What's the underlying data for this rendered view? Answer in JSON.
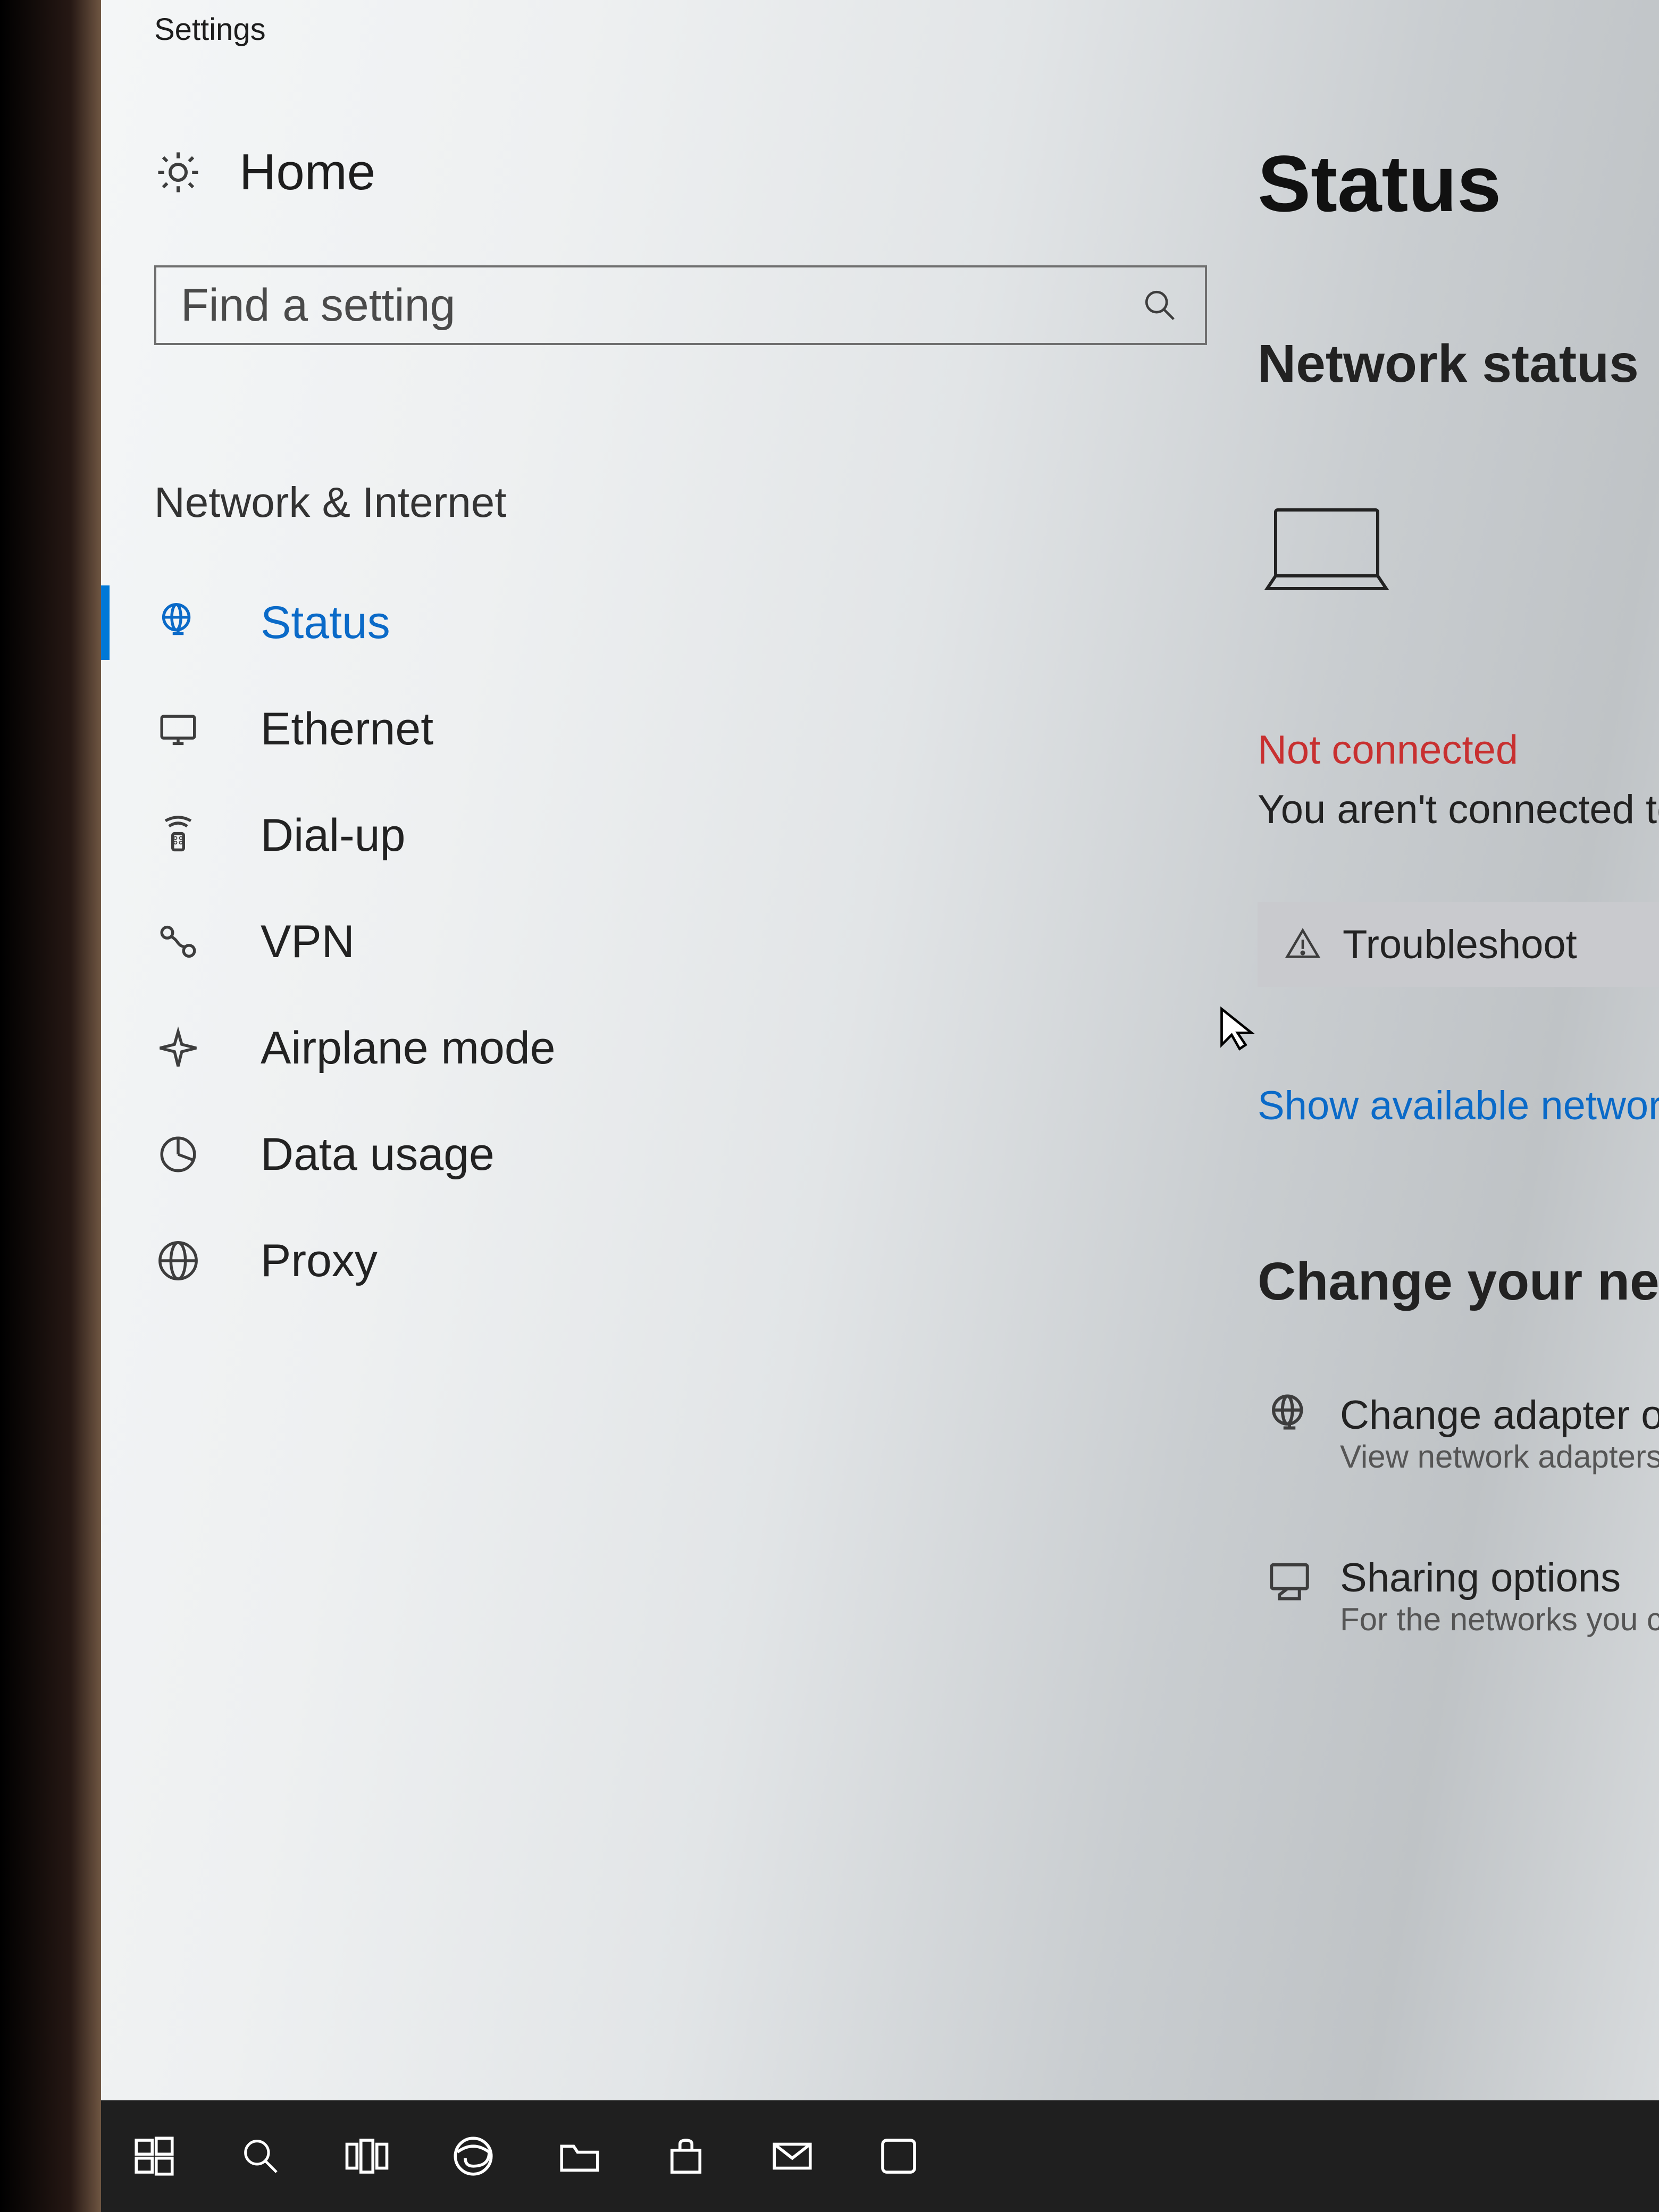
{
  "window_title": "Settings",
  "home_label": "Home",
  "search": {
    "placeholder": "Find a setting"
  },
  "category_heading": "Network & Internet",
  "nav_items": [
    {
      "label": "Status",
      "active": true,
      "icon": "globe-monitor-icon"
    },
    {
      "label": "Ethernet",
      "active": false,
      "icon": "monitor-icon"
    },
    {
      "label": "Dial-up",
      "active": false,
      "icon": "phone-icon"
    },
    {
      "label": "VPN",
      "active": false,
      "icon": "vpn-icon"
    },
    {
      "label": "Airplane mode",
      "active": false,
      "icon": "airplane-icon"
    },
    {
      "label": "Data usage",
      "active": false,
      "icon": "pie-icon"
    },
    {
      "label": "Proxy",
      "active": false,
      "icon": "globe-icon"
    }
  ],
  "main": {
    "page_title": "Status",
    "subheading": "Network status",
    "error_title": "Not connected",
    "error_body": "You aren't connected to any networks.",
    "troubleshoot_label": "Troubleshoot",
    "show_available_link": "Show available networks",
    "change_heading": "Change your network settings",
    "options": [
      {
        "title": "Change adapter options",
        "sub": "View network adapters and change connection settings.",
        "icon": "globe-monitor-icon"
      },
      {
        "title": "Sharing options",
        "sub": "For the networks you connect to, decide what you want to share.",
        "icon": "share-icon"
      }
    ]
  },
  "taskbar_items": [
    {
      "name": "start-button",
      "icon": "windows-icon"
    },
    {
      "name": "search-button",
      "icon": "search-icon"
    },
    {
      "name": "task-view-button",
      "icon": "taskview-icon"
    },
    {
      "name": "edge-button",
      "icon": "edge-icon"
    },
    {
      "name": "file-explorer-button",
      "icon": "folder-icon"
    },
    {
      "name": "store-button",
      "icon": "store-icon"
    },
    {
      "name": "mail-button",
      "icon": "mail-icon"
    },
    {
      "name": "app-button",
      "icon": "app-icon"
    }
  ]
}
